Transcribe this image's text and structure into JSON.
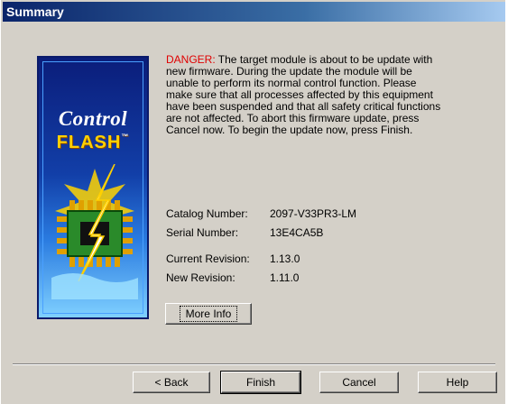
{
  "window": {
    "title": "Summary"
  },
  "logo": {
    "line1": "Control",
    "line2": "FLASH",
    "trademark": "™"
  },
  "message": {
    "danger_label": "DANGER:",
    "text": " The target module is about to be update with new firmware. During the update the module will be unable to perform its normal control function. Please make sure that all processes affected by this equipment have been suspended and that all safety critical functions are not affected. To abort this firmware update, press Cancel now. To begin the update now, press Finish."
  },
  "info": {
    "catalog_label": "Catalog Number:",
    "catalog_value": "2097-V33PR3-LM",
    "serial_label": "Serial Number:",
    "serial_value": "13E4CA5B",
    "current_label": "Current Revision:",
    "current_value": "1.13.0",
    "new_label": "New Revision:",
    "new_value": "1.11.0"
  },
  "buttons": {
    "more_info": "More Info",
    "back": "< Back",
    "finish": "Finish",
    "cancel": "Cancel",
    "help": "Help"
  },
  "colors": {
    "danger": "#e00000",
    "titlebar": "#0a246a",
    "face": "#d4d0c8"
  }
}
